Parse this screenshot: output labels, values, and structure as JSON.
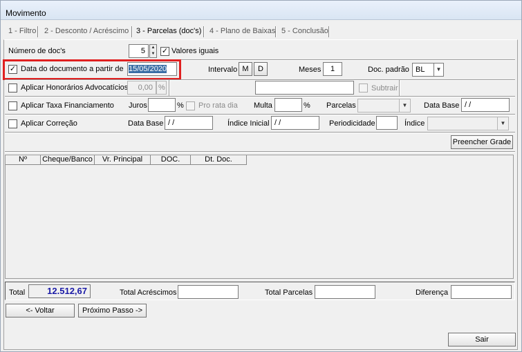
{
  "window": {
    "title": "Movimento"
  },
  "tabs": [
    {
      "label": "1 - Filtro"
    },
    {
      "label": "2 - Desconto / Acréscimo"
    },
    {
      "label": "3 - Parcelas (doc's)"
    },
    {
      "label": "4 - Plano de Baixas"
    },
    {
      "label": "5 - Conclusão"
    }
  ],
  "row1": {
    "num_docs_label": "Número de doc's",
    "num_docs_value": "5",
    "valores_iguais_label": "Valores iguais",
    "valores_iguais_checked": "✓"
  },
  "row2": {
    "data_doc_label": "Data do documento a partir de",
    "data_doc_checked": "✓",
    "data_doc_value": "15/05/2020",
    "intervalo_label": "Intervalo",
    "btn_m": "M",
    "btn_d": "D",
    "meses_label": "Meses",
    "meses_value": "1",
    "doc_padrao_label": "Doc. padrão",
    "doc_padrao_value": "BL"
  },
  "row3": {
    "honorarios_label": "Aplicar Honorários Advocatícios",
    "honorarios_value": "0,00",
    "percent": "%",
    "subtrair_label": "Subtrair"
  },
  "row4": {
    "taxa_label": "Aplicar Taxa Financiamento",
    "juros_label": "Juros",
    "percent": "%",
    "pro_rata_label": "Pro rata dia",
    "multa_label": "Multa",
    "parcelas_label": "Parcelas",
    "data_base_label": "Data Base",
    "data_base_value": "/ /"
  },
  "row5": {
    "correcao_label": "Aplicar Correção",
    "data_base_label": "Data Base",
    "data_base_value": "/ /",
    "indice_inicial_label": "Índice Inicial",
    "indice_inicial_value": "/ /",
    "periodicidade_label": "Periodicidade",
    "indice_label": "Índice"
  },
  "preencher_button": "Preencher Grade",
  "grid": {
    "columns": [
      "Nº",
      "Cheque/Banco",
      "Vr. Principal",
      "DOC.",
      "Dt. Doc."
    ]
  },
  "totals": {
    "total_label": "Total",
    "total_value": "12.512,67",
    "acrescimos_label": "Total Acréscimos",
    "parcelas_label": "Total Parcelas",
    "diferenca_label": "Diferença"
  },
  "nav": {
    "voltar": "<- Voltar",
    "proximo": "Próximo Passo ->",
    "sair": "Sair"
  }
}
